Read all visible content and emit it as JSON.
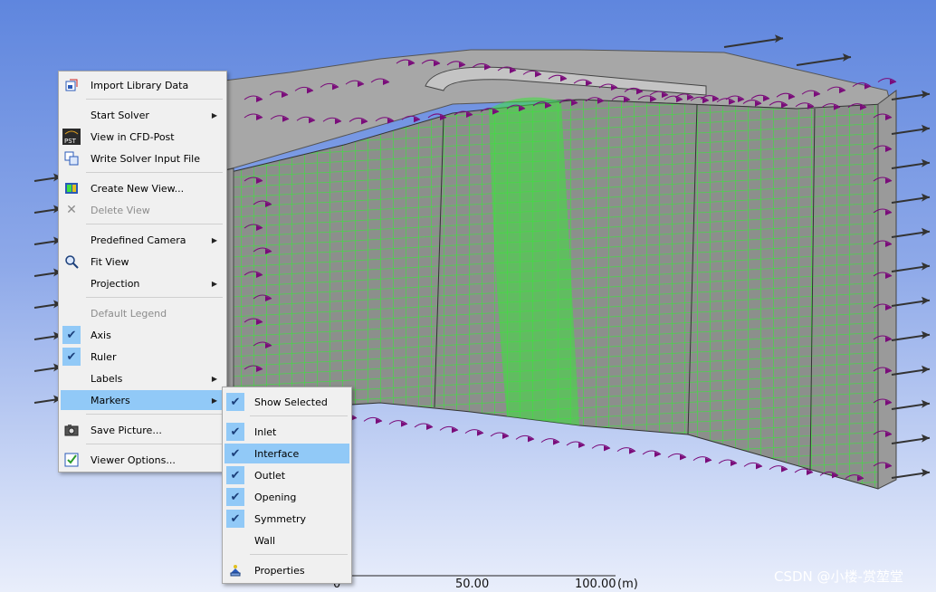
{
  "context_menu": {
    "items": [
      {
        "label": "Import Library Data",
        "icon": "import-library-icon"
      },
      {
        "label": "Start Solver",
        "submenu": true
      },
      {
        "label": "View in CFD-Post",
        "icon": "cfd-post-icon"
      },
      {
        "label": "Write Solver Input File",
        "icon": "write-file-icon"
      },
      {
        "label": "Create New View...",
        "icon": "new-view-icon"
      },
      {
        "label": "Delete View",
        "icon": "delete-icon",
        "disabled": true
      },
      {
        "label": "Predefined Camera",
        "submenu": true
      },
      {
        "label": "Fit View",
        "icon": "zoom-icon"
      },
      {
        "label": "Projection",
        "submenu": true
      },
      {
        "label": "Default Legend",
        "disabled": true
      },
      {
        "label": "Axis",
        "checked": true
      },
      {
        "label": "Ruler",
        "checked": true
      },
      {
        "label": "Labels",
        "submenu": true
      },
      {
        "label": "Markers",
        "submenu": true,
        "highlighted": true
      },
      {
        "label": "Save Picture...",
        "icon": "camera-icon"
      },
      {
        "label": "Viewer Options...",
        "icon": "options-icon"
      }
    ]
  },
  "markers_submenu": {
    "items": [
      {
        "label": "Show Selected",
        "checked": true
      },
      {
        "label": "Inlet",
        "checked": true
      },
      {
        "label": "Interface",
        "checked": true,
        "highlighted": true
      },
      {
        "label": "Outlet",
        "checked": true
      },
      {
        "label": "Opening",
        "checked": true
      },
      {
        "label": "Symmetry",
        "checked": true
      },
      {
        "label": "Wall",
        "checked": false
      },
      {
        "label": "Properties",
        "icon": "properties-icon"
      }
    ]
  },
  "ruler": {
    "labels": [
      "0",
      "50.00",
      "100.00",
      "(m)"
    ]
  },
  "watermark": "CSDN @小楼-赏堃堂",
  "colors": {
    "mesh": "#3ee23e",
    "surface": "#a9a9a9",
    "marker": "#7a0b7a",
    "hover": "#91c9f7"
  }
}
